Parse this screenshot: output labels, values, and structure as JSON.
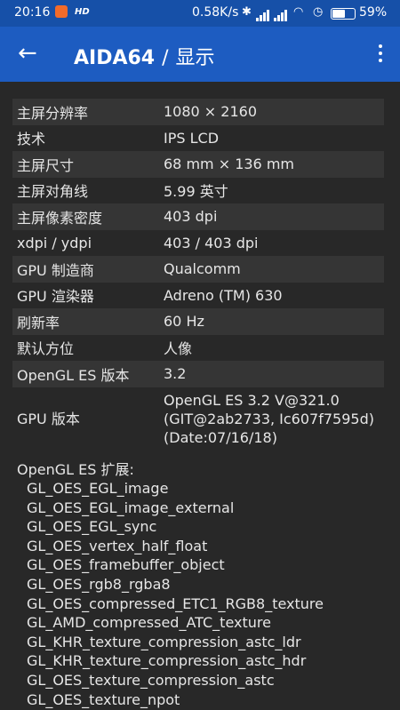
{
  "status_bar": {
    "time": "20:16",
    "hd": "HD",
    "net_speed": "0.58K/s",
    "battery": "59%"
  },
  "app_bar": {
    "back_icon": "arrow-left-icon",
    "app_name": "AIDA64",
    "separator": "/",
    "section": "显示",
    "menu_icon": "more-vert-icon"
  },
  "rows": [
    {
      "label": "主屏分辨率",
      "value": "1080 × 2160"
    },
    {
      "label": "技术",
      "value": "IPS LCD"
    },
    {
      "label": "主屏尺寸",
      "value": "68 mm × 136 mm"
    },
    {
      "label": "主屏对角线",
      "value": "5.99 英寸"
    },
    {
      "label": "主屏像素密度",
      "value": "403 dpi"
    },
    {
      "label": "xdpi / ydpi",
      "value": "403 / 403 dpi"
    },
    {
      "label": "GPU 制造商",
      "value": "Qualcomm"
    },
    {
      "label": "GPU 渲染器",
      "value": "Adreno (TM) 630"
    },
    {
      "label": "刷新率",
      "value": "60 Hz"
    },
    {
      "label": "默认方位",
      "value": "人像"
    },
    {
      "label": "OpenGL ES 版本",
      "value": "3.2"
    }
  ],
  "gpu_version": {
    "label": "GPU 版本",
    "lines": [
      "OpenGL ES 3.2 V@321.0",
      "(GIT@2ab2733, Ic607f7595d)",
      "(Date:07/16/18)"
    ]
  },
  "extensions_header": "OpenGL ES 扩展:",
  "extensions": [
    "GL_OES_EGL_image",
    "GL_OES_EGL_image_external",
    "GL_OES_EGL_sync",
    "GL_OES_vertex_half_float",
    "GL_OES_framebuffer_object",
    "GL_OES_rgb8_rgba8",
    "GL_OES_compressed_ETC1_RGB8_texture",
    "GL_AMD_compressed_ATC_texture",
    "GL_KHR_texture_compression_astc_ldr",
    "GL_KHR_texture_compression_astc_hdr",
    "GL_OES_texture_compression_astc",
    "GL_OES_texture_npot"
  ]
}
